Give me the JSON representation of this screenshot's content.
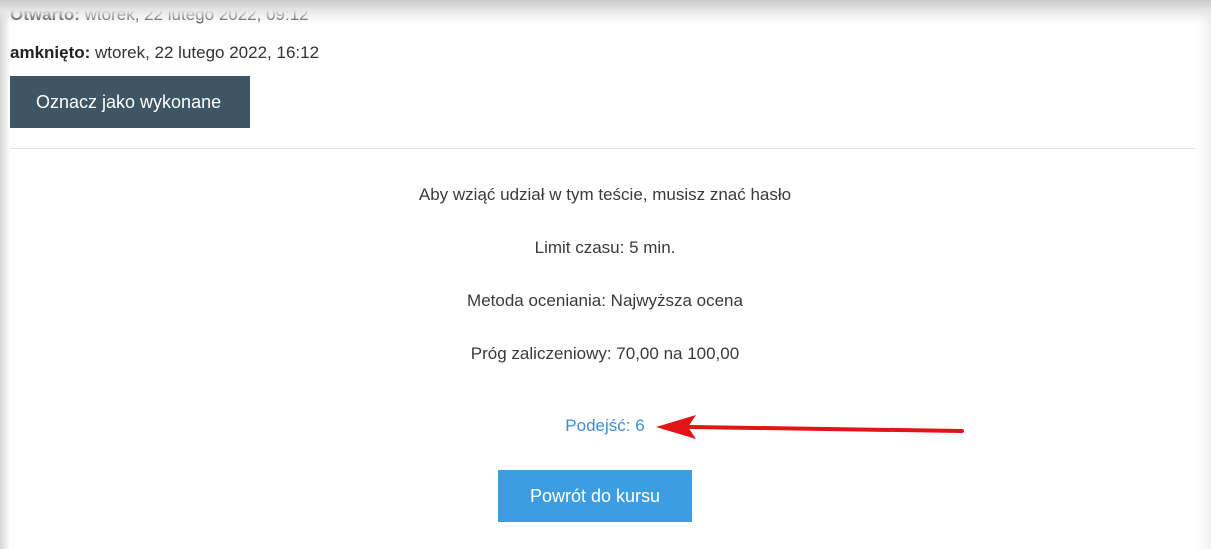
{
  "dates": {
    "opened_label": "Otwarto:",
    "opened_value": "wtorek, 22 lutego 2022, 09:12",
    "closed_label": "amknięto:",
    "closed_value": "wtorek, 22 lutego 2022, 16:12"
  },
  "actions": {
    "mark_done_label": "Oznacz jako wykonane",
    "back_to_course_label": "Powrót do kursu"
  },
  "quiz_info": {
    "password_notice": "Aby wziąć udział w tym teście, musisz znać hasło",
    "time_limit": "Limit czasu: 5 min.",
    "grading_method": "Metoda oceniania: Najwyższa ocena",
    "pass_threshold": "Próg zaliczeniowy: 70,00 na 100,00",
    "attempts": "Podejść: 6"
  },
  "colors": {
    "dark_button": "#3e5564",
    "primary_button": "#3c9de0",
    "link": "#3d8fd0",
    "annotation_arrow": "#e01515"
  },
  "annotation": {
    "arrow_icon": "red-arrow-left-icon"
  }
}
